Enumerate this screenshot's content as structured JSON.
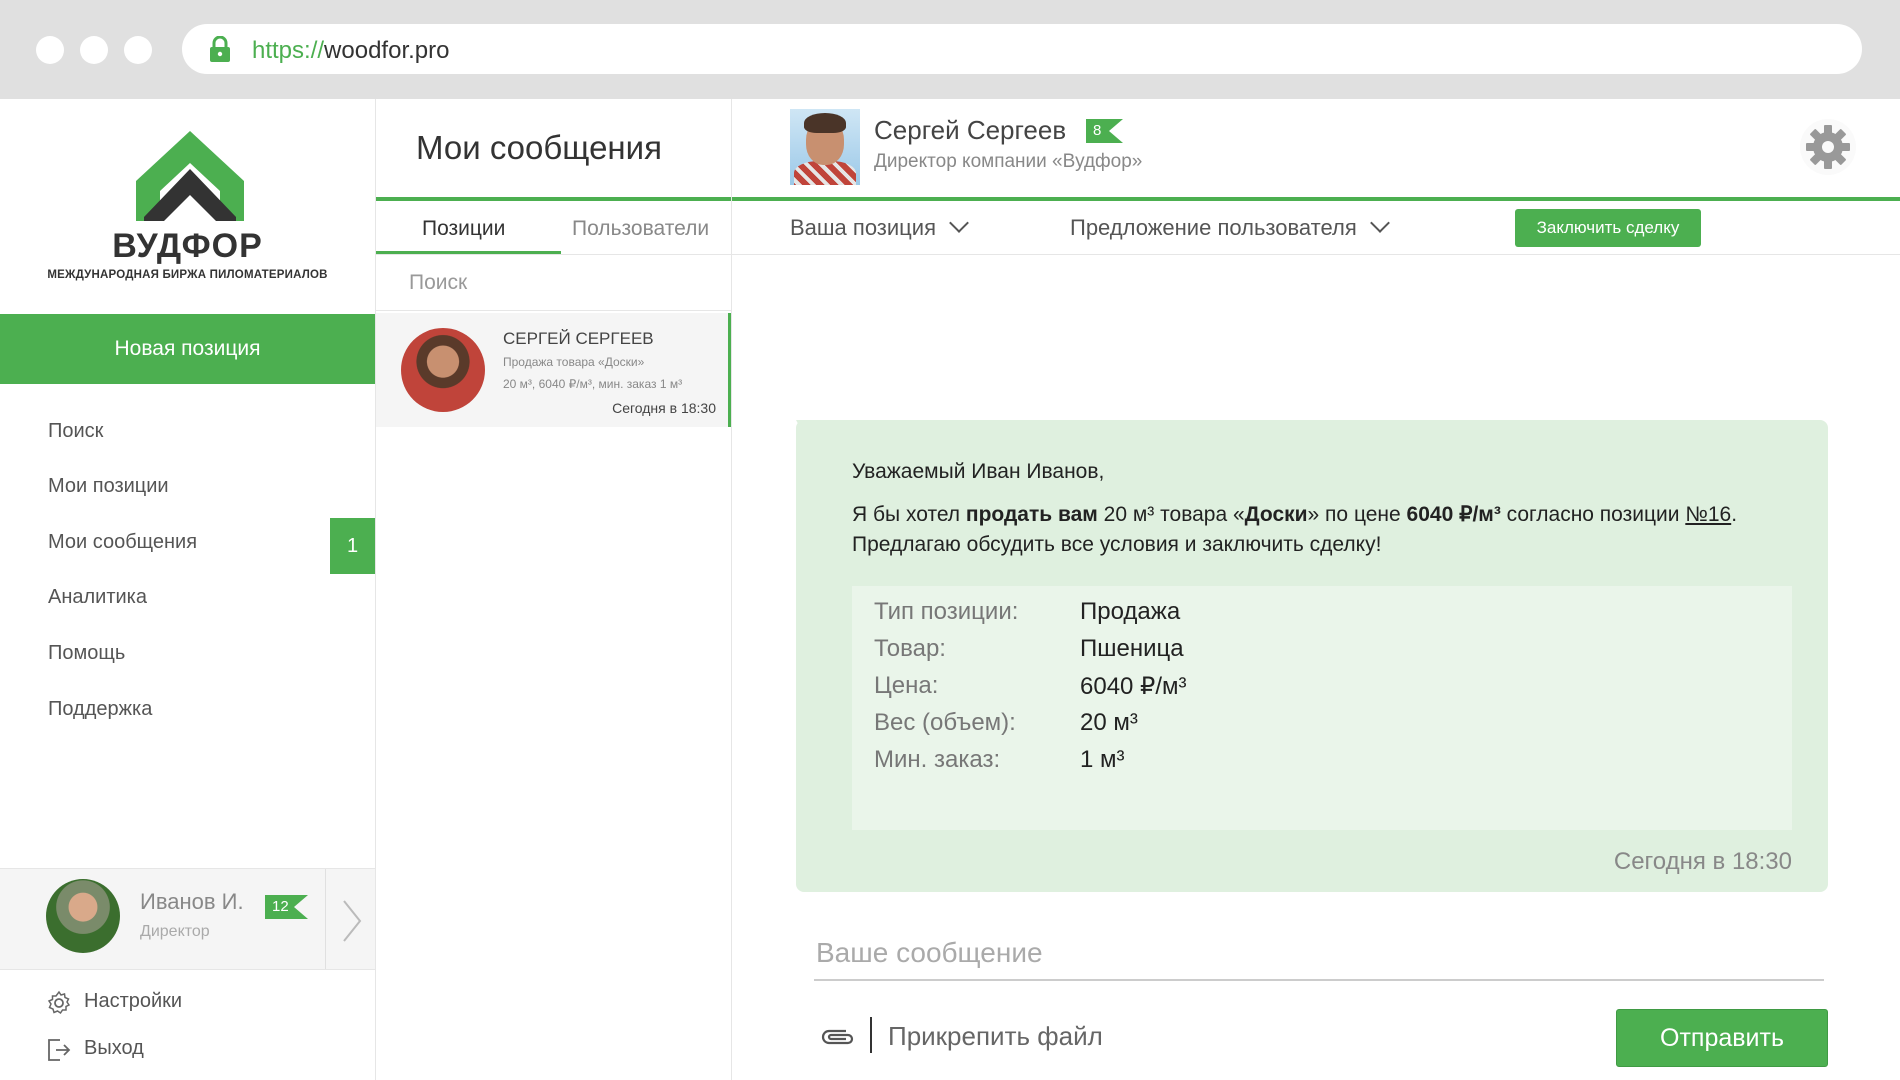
{
  "browser": {
    "url_protocol": "https://",
    "url_host": "woodfor.pro"
  },
  "sidebar": {
    "logo_title": "ВУДФОР",
    "logo_subtitle": "МЕЖДУНАРОДНАЯ БИРЖА ПИЛОМАТЕРИАЛОВ",
    "new_position_label": "Новая позиция",
    "nav": [
      {
        "label": "Поиск"
      },
      {
        "label": "Мои позиции"
      },
      {
        "label": "Мои сообщения",
        "badge": "1"
      },
      {
        "label": "Аналитика"
      },
      {
        "label": "Помощь"
      },
      {
        "label": "Поддержка"
      }
    ],
    "user": {
      "name": "Иванов И.",
      "role": "Директор",
      "badge": "12"
    },
    "footer": {
      "settings_label": "Настройки",
      "logout_label": "Выход"
    }
  },
  "conversations": {
    "title": "Мои сообщения",
    "tabs": [
      {
        "label": "Позиции",
        "active": true
      },
      {
        "label": "Пользователи",
        "active": false
      }
    ],
    "search_placeholder": "Поиск",
    "items": [
      {
        "name": "СЕРГЕЙ СЕРГЕЕВ",
        "line1": "Продажа товара «Доски»",
        "line2": "20 м³, 6040 ₽/м³, мин. заказ 1 м³",
        "time": "Сегодня в 18:30"
      }
    ]
  },
  "chat": {
    "contact": {
      "name": "Сергей Сергеев",
      "badge": "8",
      "role": "Директор компании «Вудфор»"
    },
    "dropdown_your_position": "Ваша позиция",
    "dropdown_user_offer": "Предложение пользователя",
    "deal_button": "Заключить сделку",
    "message": {
      "greeting": "Уважаемый Иван Иванов,",
      "p1": "Я бы хотел ",
      "b1": "продать вам",
      "p2": " 20 м³ товара «",
      "b2": "Доски",
      "p3": "» по цене ",
      "b3": "6040 ₽/м³",
      "p4": " согласно позиции ",
      "link": "№16",
      "p5": ". Предлагаю обсудить все условия и заключить сделку!",
      "details": [
        {
          "label": "Тип позиции:",
          "value": "Продажа"
        },
        {
          "label": "Товар:",
          "value": "Пшеница"
        },
        {
          "label": "Цена:",
          "value": "6040 ₽/м³"
        },
        {
          "label": "Вес (объем):",
          "value": "20 м³"
        },
        {
          "label": "Мин. заказ:",
          "value": "1 м³"
        }
      ],
      "time": "Сегодня в 18:30"
    },
    "input_placeholder": "Ваше сообщение",
    "attach_label": "Прикрепить файл",
    "send_label": "Отправить"
  },
  "colors": {
    "accent": "#4caf50",
    "bubble": "#dff0df"
  }
}
